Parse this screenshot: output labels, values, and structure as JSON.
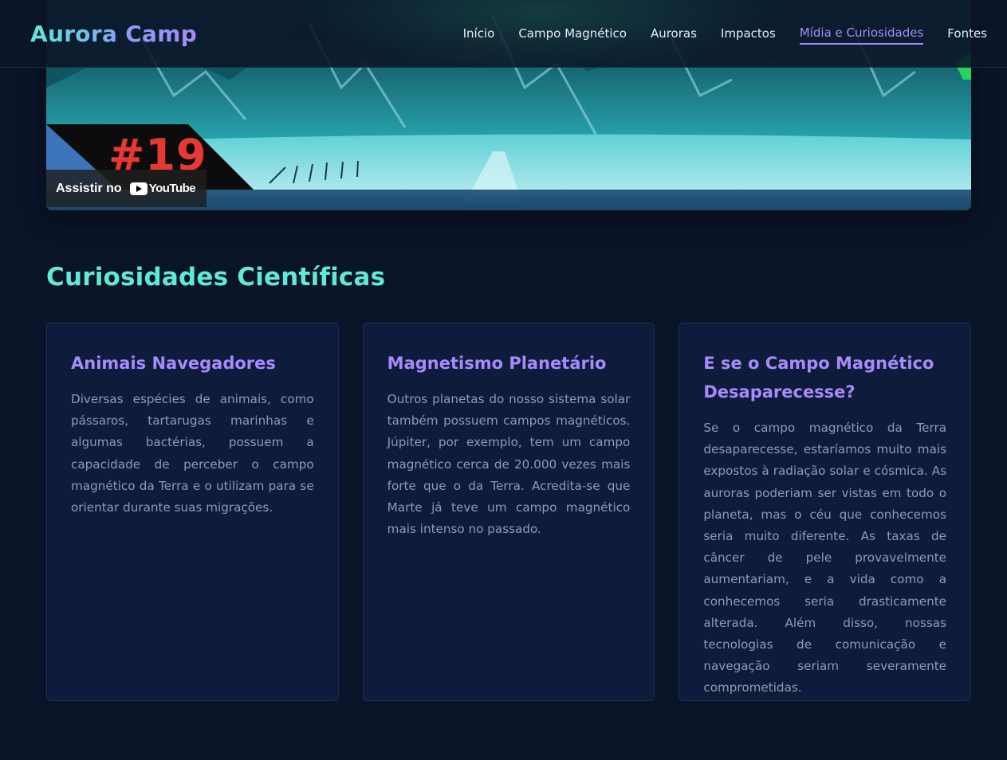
{
  "header": {
    "brand": "Aurora Camp",
    "nav": [
      {
        "label": "Início",
        "active": false
      },
      {
        "label": "Campo Magnético",
        "active": false
      },
      {
        "label": "Auroras",
        "active": false
      },
      {
        "label": "Impactos",
        "active": false
      },
      {
        "label": "Mídia e Curiosidades",
        "active": true
      },
      {
        "label": "Fontes",
        "active": false
      }
    ]
  },
  "video": {
    "episode_number": "#19",
    "watch_label": "Assistir no",
    "youtube_wordmark": "YouTube"
  },
  "curiosities": {
    "title": "Curiosidades Científicas",
    "cards": [
      {
        "title": "Animais Navegadores",
        "text": "Diversas espécies de animais, como pássaros, tartarugas marinhas e algumas bactérias, possuem a capacidade de perceber o campo magnético da Terra e o utilizam para se orientar durante suas migrações."
      },
      {
        "title": "Magnetismo Planetário",
        "text": "Outros planetas do nosso sistema solar também possuem campos magnéticos. Júpiter, por exemplo, tem um campo magnético cerca de 20.000 vezes mais forte que o da Terra. Acredita-se que Marte já teve um campo magnético mais intenso no passado."
      },
      {
        "title": "E se o Campo Magnético Desaparecesse?",
        "text": "Se o campo magnético da Terra desaparecesse, estaríamos muito mais expostos à radiação solar e cósmica. As auroras poderiam ser vistas em todo o planeta, mas o céu que conhecemos seria muito diferente. As taxas de câncer de pele provavelmente aumentariam, e a vida como a conhecemos seria drasticamente alterada. Além disso, nossas tecnologias de comunicação e navegação seriam severamente comprometidas."
      }
    ]
  },
  "colors": {
    "background": "#0a1429",
    "card_background": "#0f1b3a",
    "accent_teal": "#5eead4",
    "accent_purple": "#a78bfa",
    "body_text": "#8f9bb5"
  }
}
